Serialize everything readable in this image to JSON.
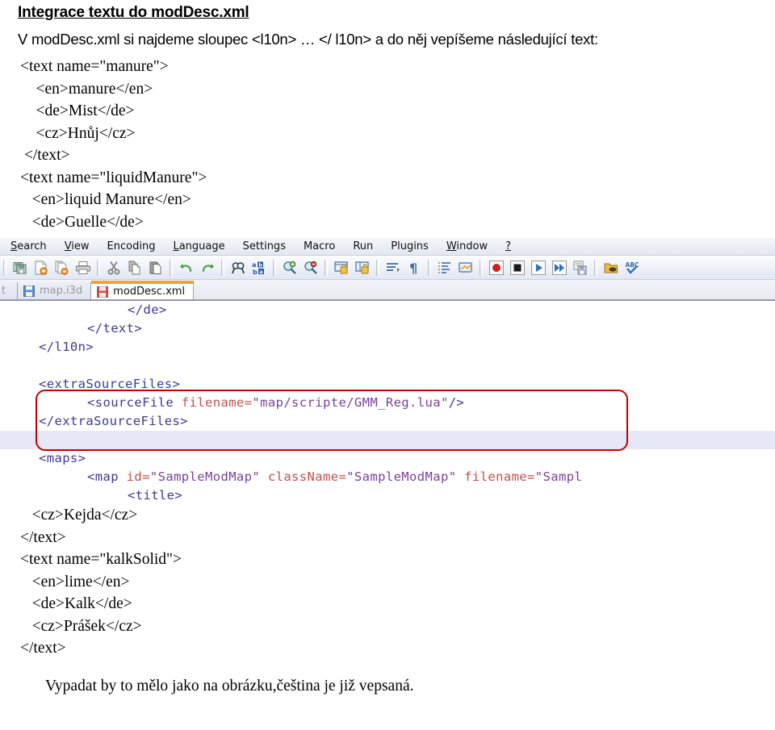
{
  "document": {
    "title": "Integrace textu do modDesc.xml",
    "intro": "V modDesc.xml si najdeme sloupec <l10n> … </ l10n> a do něj vepíšeme následující text:",
    "xml_top": "<text name=\"manure\">\n    <en>manure</en>\n    <de>Mist</de>\n    <cz>Hnůj</cz>\n </text>\n<text name=\"liquidManure\">\n   <en>liquid Manure</en>\n   <de>Guelle</de>",
    "xml_bottom": "   <cz>Kejda</cz>\n</text>\n<text name=\"kalkSolid\">\n   <en>lime</en>\n   <de>Kalk</de>\n   <cz>Prášek</cz>\n</text>",
    "caption": "Vypadat by to mělo jako na obrázku,čeština je již vepsaná."
  },
  "notepad": {
    "menu": [
      {
        "name": "menu-search",
        "pre": "S",
        "rest": "earch"
      },
      {
        "name": "menu-view",
        "pre": "V",
        "rest": "iew"
      },
      {
        "name": "menu-encoding",
        "pre": "",
        "rest": "Encoding"
      },
      {
        "name": "menu-language",
        "pre": "L",
        "rest": "anguage"
      },
      {
        "name": "menu-settings",
        "pre": "",
        "rest": "Settings"
      },
      {
        "name": "menu-macro",
        "pre": "",
        "rest": "Macro"
      },
      {
        "name": "menu-run",
        "pre": "",
        "rest": "Run"
      },
      {
        "name": "menu-plugins",
        "pre": "",
        "rest": "Plugins"
      },
      {
        "name": "menu-window",
        "pre": "W",
        "rest": "indow"
      },
      {
        "name": "menu-help",
        "pre": "?",
        "rest": ""
      }
    ],
    "toolbar_icons": [
      "save-icon",
      "save-as-icon",
      "save-all-icon",
      "print-icon",
      "cut-icon",
      "copy-icon",
      "paste-icon",
      "undo-icon",
      "redo-icon",
      "find-icon",
      "replace-icon",
      "zoom-in-icon",
      "zoom-out-icon",
      "sync-vertical-icon",
      "sync-horizontal-icon",
      "word-wrap-icon",
      "show-all-chars-icon",
      "indent-guide-icon",
      "user-define-icon",
      "macro-record-icon",
      "macro-stop-icon",
      "macro-play-icon",
      "macro-run-multiple-icon",
      "macro-save-icon",
      "run-icon",
      "spell-check-icon"
    ],
    "tabs": [
      {
        "label": "t",
        "state": "clipped",
        "icon": "file-icon"
      },
      {
        "label": "map.i3d",
        "state": "inactive",
        "icon": "file-blue-icon"
      },
      {
        "label": "modDesc.xml",
        "state": "active",
        "icon": "file-red-icon"
      }
    ],
    "editor": {
      "lines": [
        {
          "indent": 110,
          "highlight": false,
          "segs": [
            {
              "t": "</de>",
              "c": "punct"
            }
          ]
        },
        {
          "indent": 60,
          "highlight": false,
          "segs": [
            {
              "t": "</text>",
              "c": "punct"
            }
          ]
        },
        {
          "indent": 0,
          "highlight": false,
          "segs": [
            {
              "t": "</l10n>",
              "c": "punct"
            }
          ]
        },
        {
          "indent": 0,
          "highlight": false,
          "segs": []
        },
        {
          "indent": 0,
          "highlight": false,
          "segs": [
            {
              "t": "<extraSourceFiles>",
              "c": "tagname"
            }
          ]
        },
        {
          "indent": 60,
          "highlight": false,
          "segs": [
            {
              "t": "<sourceFile ",
              "c": "tagname"
            },
            {
              "t": "filename=",
              "c": "attr"
            },
            {
              "t": "\"map/scripte/GMM_Reg.lua\"",
              "c": "val"
            },
            {
              "t": "/>",
              "c": "tagname"
            }
          ]
        },
        {
          "indent": 0,
          "highlight": false,
          "segs": [
            {
              "t": "</extraSourceFiles>",
              "c": "tagname"
            }
          ]
        },
        {
          "indent": 0,
          "highlight": true,
          "segs": []
        },
        {
          "indent": 0,
          "highlight": false,
          "segs": [
            {
              "t": "<maps>",
              "c": "tagname"
            }
          ]
        },
        {
          "indent": 60,
          "highlight": false,
          "segs": [
            {
              "t": "<map ",
              "c": "tagname"
            },
            {
              "t": "id=",
              "c": "attr"
            },
            {
              "t": "\"SampleModMap\"",
              "c": "val"
            },
            {
              "t": " ",
              "c": "tagname"
            },
            {
              "t": "className=",
              "c": "attr"
            },
            {
              "t": "\"SampleModMap\"",
              "c": "val"
            },
            {
              "t": " ",
              "c": "tagname"
            },
            {
              "t": "filename=",
              "c": "attr"
            },
            {
              "t": "\"Sampl",
              "c": "val"
            }
          ]
        },
        {
          "indent": 110,
          "highlight": false,
          "segs": [
            {
              "t": "<title>",
              "c": "tagname"
            }
          ]
        }
      ],
      "highlight_color": "#e7e8f7",
      "annotation_box_color": "#c00000"
    }
  }
}
